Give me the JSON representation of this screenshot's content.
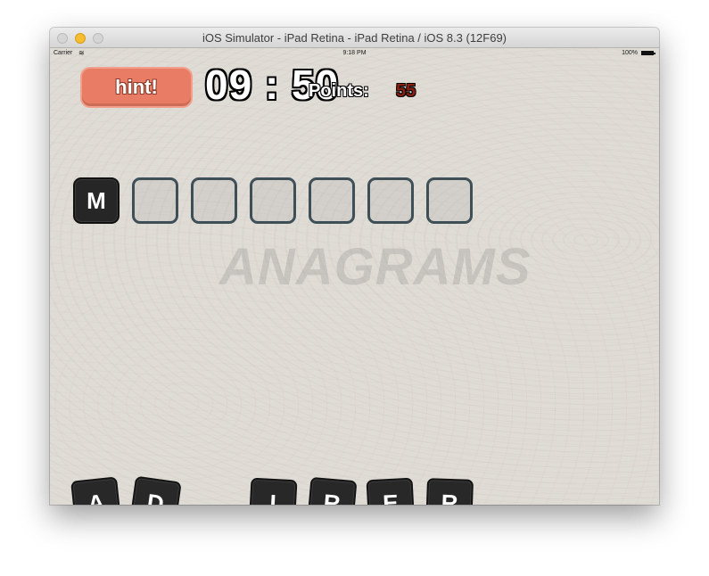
{
  "window": {
    "title": "iOS Simulator - iPad Retina - iPad Retina / iOS 8.3 (12F69)"
  },
  "status_bar": {
    "carrier": "Carrier",
    "wifi_icon": "wifi-icon",
    "time": "9:18 PM",
    "battery": "100%",
    "battery_icon": "battery-icon"
  },
  "game": {
    "hint_label": "hint!",
    "timer": "09 : 50",
    "points_label": "Points:",
    "points_value": "55",
    "logo": "ANAGRAMS",
    "target_slots": [
      "M",
      "",
      "",
      "",
      "",
      "",
      ""
    ],
    "tiles": [
      "A",
      "D",
      "I",
      "R",
      "E",
      "R"
    ],
    "colors": {
      "hint_button": "#e97c64",
      "points_value": "#8a1f12",
      "tile_background": "#282828",
      "slot_border": "#3e4f58",
      "board_background": "#dfdbd5"
    }
  }
}
